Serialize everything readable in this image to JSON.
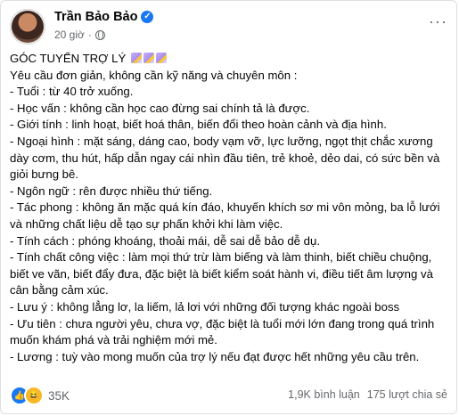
{
  "post": {
    "author": "Trần Bảo Bảo",
    "time": "20 giờ",
    "title": "GÓC TUYỂN TRỢ LÝ",
    "lines": [
      "Yêu cầu đơn giản, không cần kỹ năng và chuyên môn :",
      "- Tuổi : từ 40 trở xuống.",
      "- Học vấn : không cần học cao đừng sai chính tả là được.",
      "- Giới tính : linh hoạt, biết hoá thân, biến đổi theo hoàn cảnh và địa hình.",
      "- Ngoại hình : mặt sáng, dáng cao, body vạm vỡ, lực lưỡng, ngọt thịt chắc xương dày cơm, thu hút, hấp dẫn ngay cái nhìn đầu tiên, trẻ khoẻ, dẻo dai, có sức bền và giỏi bưng bê.",
      "- Ngôn ngữ : rên được nhiều thứ tiếng.",
      "- Tác phong : không ăn mặc quá kín đáo, khuyến khích sơ mi vôn mỏng, ba lỗ lưới và những chất liệu dễ tạo sự phấn khởi khi làm việc.",
      "- Tính cách : phóng khoáng, thoải mái, dễ sai dễ bảo dễ dụ.",
      "- Tính chất công việc : làm mọi thứ trừ làm biếng và làm thinh, biết chiều chuộng, biết ve vãn, biết đẩy đưa, đặc biệt là biết kiểm soát hành vi, điều tiết âm lượng và cân bằng cảm xúc.",
      "- Lưu ý : không lẳng lơ, la liếm, lả lơi với những đối tượng khác ngoài boss",
      "- Ưu tiên : chưa người yêu, chưa vợ, đặc biệt là tuổi mới lớn đang trong quá trình muốn khám phá và trải nghiệm mới mẻ.",
      "- Lương : tuỳ vào mong muốn của trợ lý nếu đạt được hết những yêu cầu trên."
    ]
  },
  "footer": {
    "reaction_count": "35K",
    "comments": "1,9K bình luận",
    "shares": "175 lượt chia sẻ"
  },
  "icons": [
    "avatar",
    "verified-icon",
    "globe-icon",
    "more-icon",
    "memo-emoji-icon",
    "like-icon",
    "haha-icon"
  ],
  "colors": {
    "accent": "#1877f2",
    "secondary_text": "#65676b"
  }
}
